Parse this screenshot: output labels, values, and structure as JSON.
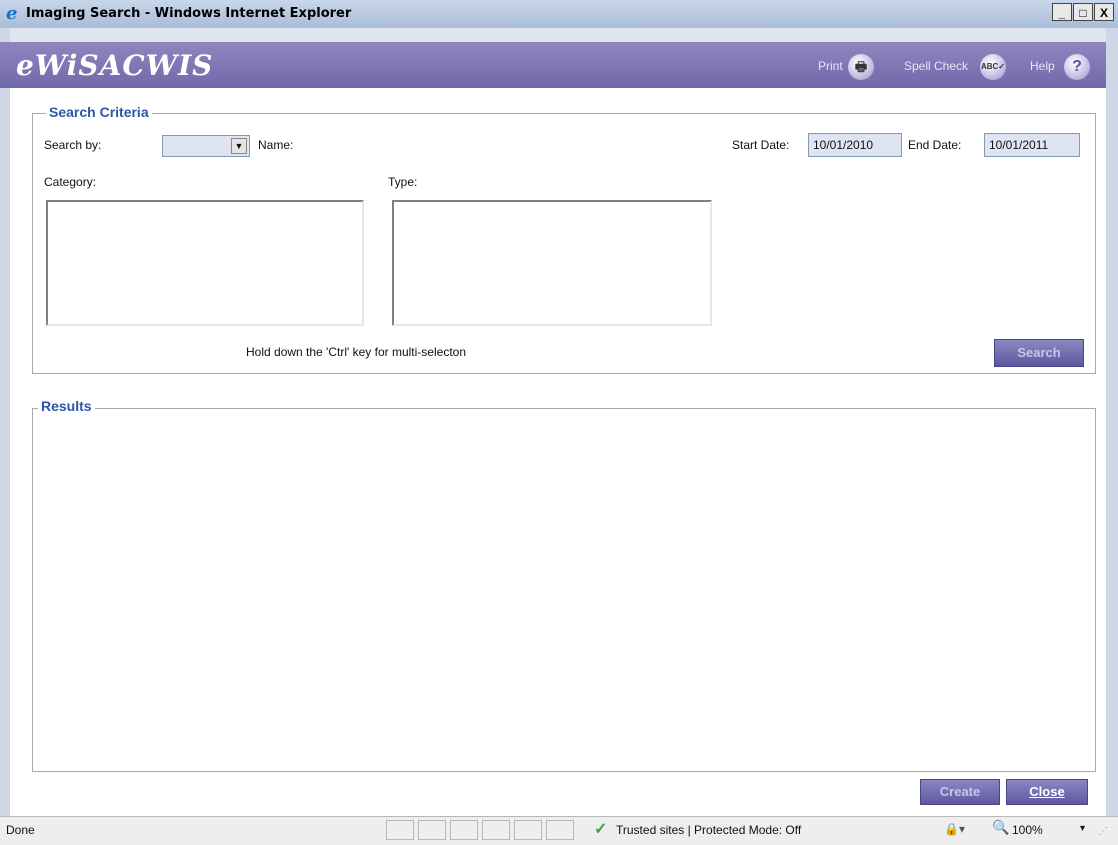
{
  "window": {
    "title": "Imaging Search - Windows Internet Explorer",
    "controls": {
      "minimize": "_",
      "maximize": "□",
      "close": "X"
    }
  },
  "app": {
    "logo": "eWiSACWIS",
    "header_links": [
      {
        "label": "Print",
        "icon": "printer-icon",
        "glyph": "🖶"
      },
      {
        "label": "Spell Check",
        "icon": "spellcheck-icon",
        "glyph": "ABC✓"
      },
      {
        "label": "Help",
        "icon": "help-icon",
        "glyph": "?"
      }
    ]
  },
  "search_criteria": {
    "legend": "Search Criteria",
    "search_by_label": "Search by:",
    "search_by_value": "",
    "name_label": "Name:",
    "start_date_label": "Start Date:",
    "start_date_value": "10/01/2010",
    "end_date_label": "End Date:",
    "end_date_value": "10/01/2011",
    "category_label": "Category:",
    "type_label": "Type:",
    "hint": "Hold down the 'Ctrl' key for multi-selecton",
    "search_button": "Search"
  },
  "results": {
    "legend": "Results"
  },
  "footer": {
    "create_button": "Create",
    "close_button": "Close"
  },
  "statusbar": {
    "status": "Done",
    "zone": "Trusted sites | Protected Mode: Off",
    "zoom": "100%"
  },
  "colors": {
    "header_bg": "#7f77b6",
    "legend_text": "#2d55a8",
    "button_bg": "#6b65ab"
  }
}
